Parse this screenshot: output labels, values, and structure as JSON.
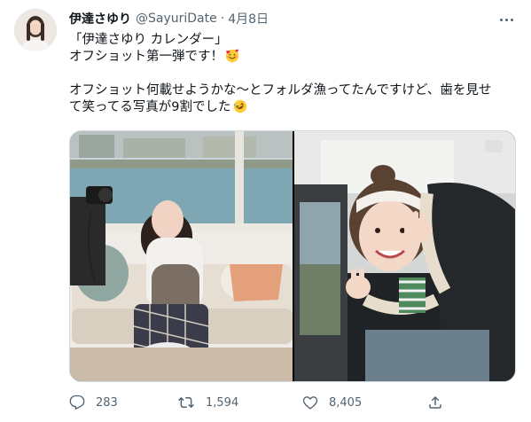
{
  "tweet": {
    "display_name": "伊達さゆり",
    "handle": "@SayuriDate",
    "separator": "·",
    "date": "4月8日",
    "lines": [
      "「伊達さゆり カレンダー」",
      "オフショット第一弾です！",
      "",
      "オフショット何載せようかな～とフォルダ漁ってたんですけど、歯を見せ",
      "て笑ってる写真が9割でした"
    ],
    "emojis": [
      "smiling-face-with-hearts",
      "rolling-on-floor-laughing"
    ]
  },
  "actions": {
    "reply_count": "283",
    "retweet_count": "1,594",
    "like_count": "8,405"
  },
  "icons": {
    "more": "more-dots-icon",
    "reply": "reply-icon",
    "retweet": "retweet-icon",
    "like": "heart-icon",
    "share": "share-icon"
  },
  "colors": {
    "primary_text": "#0f1419",
    "secondary_text": "#536471",
    "border": "#cfd9de"
  }
}
